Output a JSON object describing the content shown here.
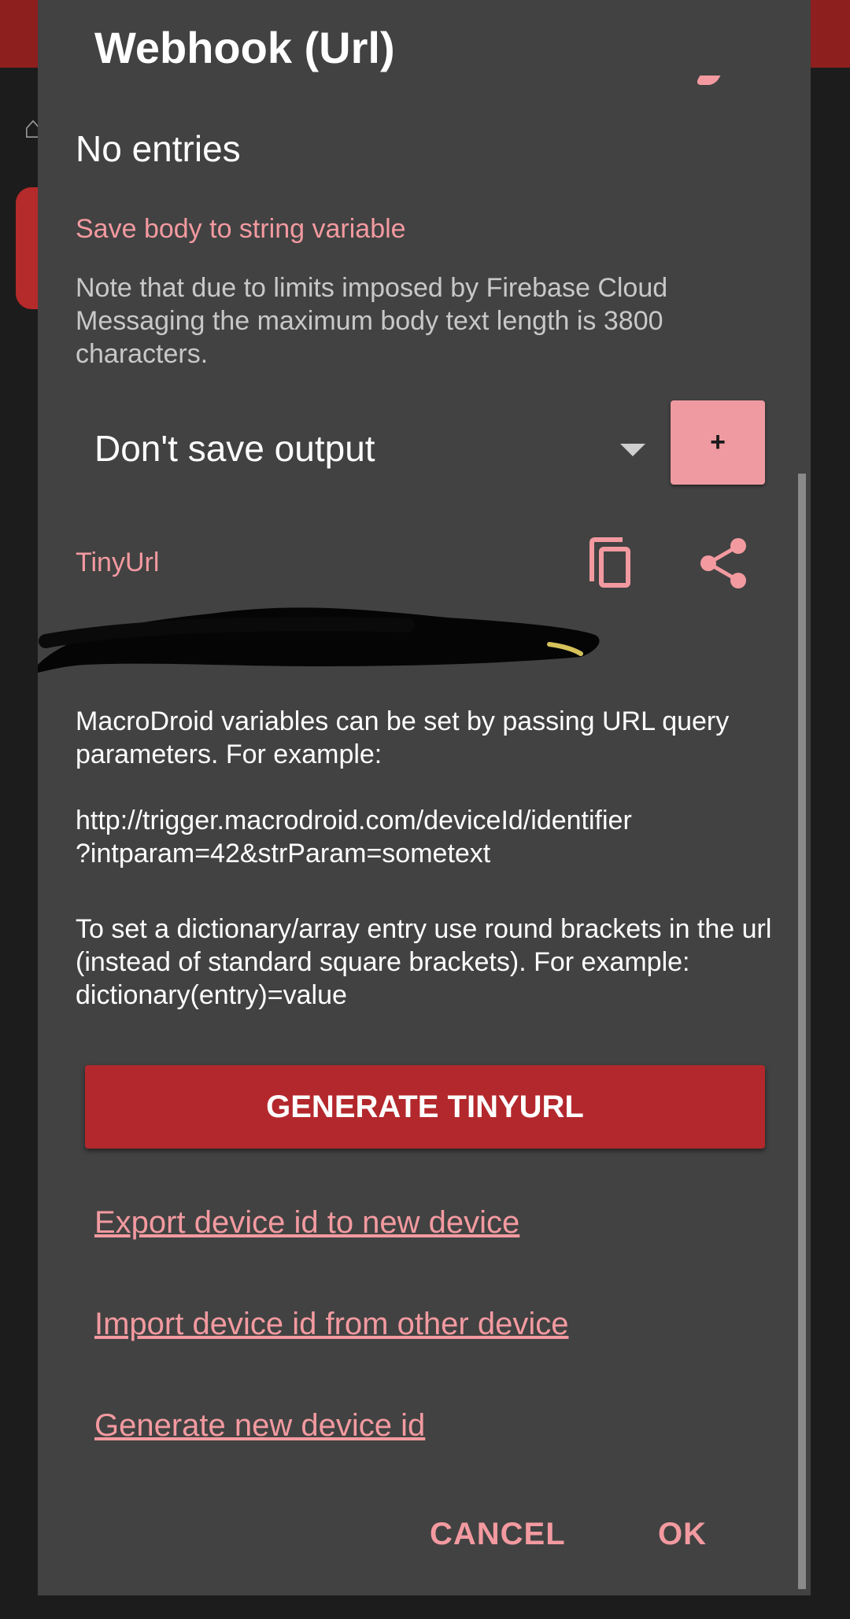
{
  "dialog": {
    "title": "Webhook (Url)",
    "no_entries": "No entries",
    "save_body_label": "Save body to string variable",
    "note": "Note that due to limits imposed by Firebase Cloud Messaging the maximum body text length is 3800 characters.",
    "output_select": {
      "selected": "Don't save output",
      "icon": "dropdown-arrow-icon"
    },
    "add_button": "+",
    "tinyurl_label": "TinyUrl",
    "copy_icon": "copy-icon",
    "share_icon": "share-icon",
    "macro_help": "MacroDroid variables can be set by passing URL query parameters. For example:",
    "example_url_line1": "http://trigger.macrodroid.com/deviceId/identifier",
    "example_url_line2": "?intparam=42&strParam=sometext",
    "dict_help": "To set a dictionary/array entry use round brackets in the url (instead of standard square brackets). For example: dictionary(entry)=value",
    "generate_button": "GENERATE TINYURL",
    "links": {
      "export": "Export device id to new device",
      "import": "Import device id from other device",
      "new_id": "Generate new device id"
    },
    "actions": {
      "cancel": "CANCEL",
      "ok": "OK"
    }
  },
  "colors": {
    "accent": "#f39aa0",
    "primary_button": "#b3282c",
    "dialog_bg": "#424242",
    "toolbar": "#8e1f1f"
  }
}
